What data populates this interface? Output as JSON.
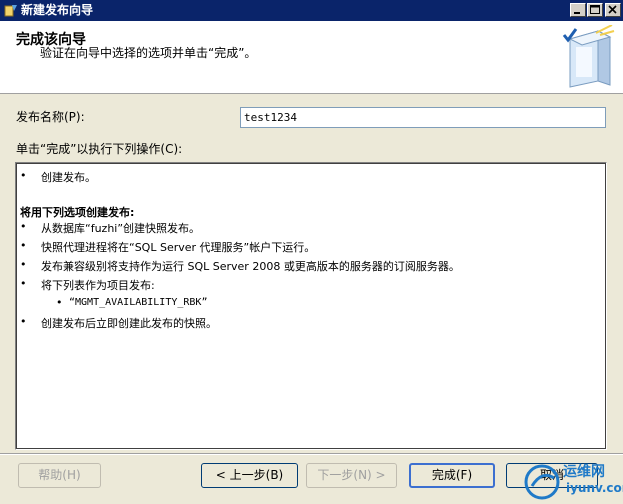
{
  "window": {
    "title": "新建发布向导",
    "controls": {
      "minimize": "minimize",
      "maximize": "maximize",
      "close": "close"
    }
  },
  "header": {
    "title": "完成该向导",
    "subtitle": "验证在向导中选择的选项并单击“完成”。"
  },
  "form": {
    "publication_name_label": "发布名称(P):",
    "publication_name_value": "test1234",
    "actions_label": "单击“完成”以执行下列操作(C):"
  },
  "summary": {
    "bullet": "•",
    "item1": "创建发布。",
    "section_heading": "将用下列选项创建发布:",
    "item2": "从数据库“fuzhi”创建快照发布。",
    "item3": "快照代理进程将在“SQL Server 代理服务”帐户下运行。",
    "item4": "发布兼容级别将支持作为运行 SQL Server 2008 或更高版本的服务器的订阅服务器。",
    "item5": "将下列表作为项目发布:",
    "sub_item": "“MGMT_AVAILABILITY_RBK”",
    "item6": "创建发布后立即创建此发布的快照。"
  },
  "buttons": {
    "help": "帮助(H)",
    "back": "< 上一步(B)",
    "next": "下一步(N) >",
    "finish": "完成(F)",
    "cancel": "取消"
  },
  "watermark": {
    "line1": "运维网",
    "line2": "iyunv.com"
  },
  "colors": {
    "titlebar": "#0a246a",
    "dialog_bg": "#ece9d8",
    "accent_blue": "#1f7ac8"
  }
}
